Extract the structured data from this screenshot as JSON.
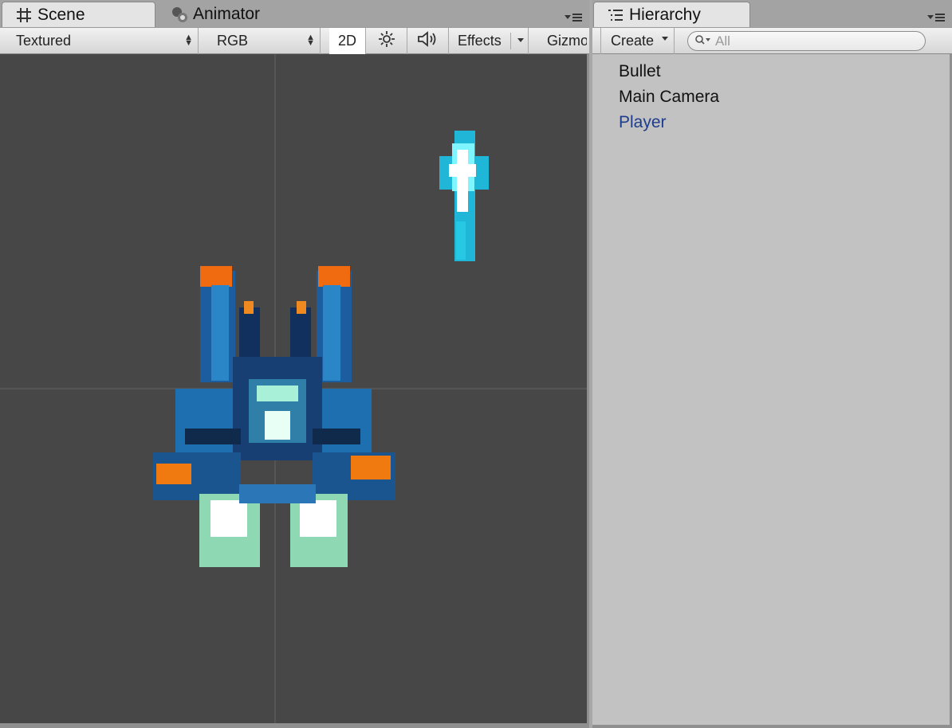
{
  "scene_panel": {
    "tabs": [
      {
        "label": "Scene",
        "icon": "grid-icon",
        "active": true
      },
      {
        "label": "Animator",
        "icon": "animator-icon",
        "active": false
      }
    ],
    "toolbar": {
      "shading_mode": "Textured",
      "render_mode": "RGB",
      "mode_2d": "2D",
      "lighting_icon": "sun-icon",
      "audio_icon": "speaker-icon",
      "effects_label": "Effects",
      "gizmos_label": "Gizmos"
    }
  },
  "hierarchy_panel": {
    "tab_label": "Hierarchy",
    "tab_icon": "hierarchy-icon",
    "create_label": "Create",
    "search_placeholder": "All",
    "items": [
      {
        "label": "Bullet",
        "selected": false
      },
      {
        "label": "Main Camera",
        "selected": false
      },
      {
        "label": "Player",
        "selected": true
      }
    ]
  },
  "colors": {
    "viewport_bg": "#474747",
    "selected_text": "#1f3b8c",
    "list_bg": "#c2c2c2"
  }
}
